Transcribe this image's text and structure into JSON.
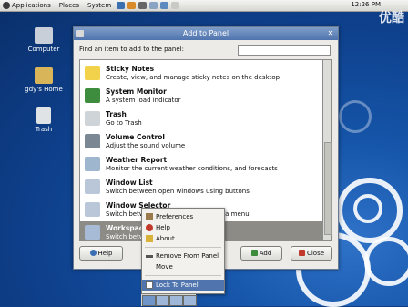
{
  "top_panel": {
    "menus": [
      "Applications",
      "Places",
      "System"
    ],
    "clock": "12:26 PM",
    "watermark": "优酷"
  },
  "desktop_icons": [
    {
      "label": "Computer",
      "icon": "computer-icon",
      "color": "#c8cfd8"
    },
    {
      "label": "gdy's Home",
      "icon": "home-folder-icon",
      "color": "#d9b55a"
    },
    {
      "label": "Trash",
      "icon": "trash-icon",
      "color": "#dfe3e6"
    }
  ],
  "dialog": {
    "title": "Add to Panel",
    "find_label": "Find an item to add to the panel:",
    "find_value": "",
    "items": [
      {
        "name": "Sticky Notes",
        "desc": "Create, view, and manage sticky notes on the desktop",
        "icon": "sticky-notes-icon",
        "color": "#f2d24a"
      },
      {
        "name": "System Monitor",
        "desc": "A system load indicator",
        "icon": "system-monitor-icon",
        "color": "#3e8c3e"
      },
      {
        "name": "Trash",
        "desc": "Go to Trash",
        "icon": "trash-icon",
        "color": "#cfd4d8"
      },
      {
        "name": "Volume Control",
        "desc": "Adjust the sound volume",
        "icon": "speaker-icon",
        "color": "#7c8794"
      },
      {
        "name": "Weather Report",
        "desc": "Monitor the current weather conditions, and forecasts",
        "icon": "weather-icon",
        "color": "#9fb6cf"
      },
      {
        "name": "Window List",
        "desc": "Switch between open windows using buttons",
        "icon": "window-list-icon",
        "color": "#b9c7d9"
      },
      {
        "name": "Window Selector",
        "desc": "Switch between open windows using a menu",
        "icon": "window-selector-icon",
        "color": "#b9c7d9"
      },
      {
        "name": "Workspace Switcher",
        "desc": "Switch between workspaces",
        "icon": "workspace-switcher-icon",
        "color": "#a7bbd6"
      }
    ],
    "buttons": {
      "help": "Help",
      "add": "Add",
      "close": "Close"
    }
  },
  "context_menu": {
    "items": [
      {
        "label": "Preferences",
        "icon": "preferences-icon"
      },
      {
        "label": "Help",
        "icon": "help-icon"
      },
      {
        "label": "About",
        "icon": "about-icon"
      },
      {
        "label": "Remove From Panel",
        "icon": "remove-icon"
      },
      {
        "label": "Move",
        "icon": "move-icon"
      },
      {
        "label": "Lock To Panel",
        "icon": "lock-checkbox-icon"
      }
    ]
  }
}
